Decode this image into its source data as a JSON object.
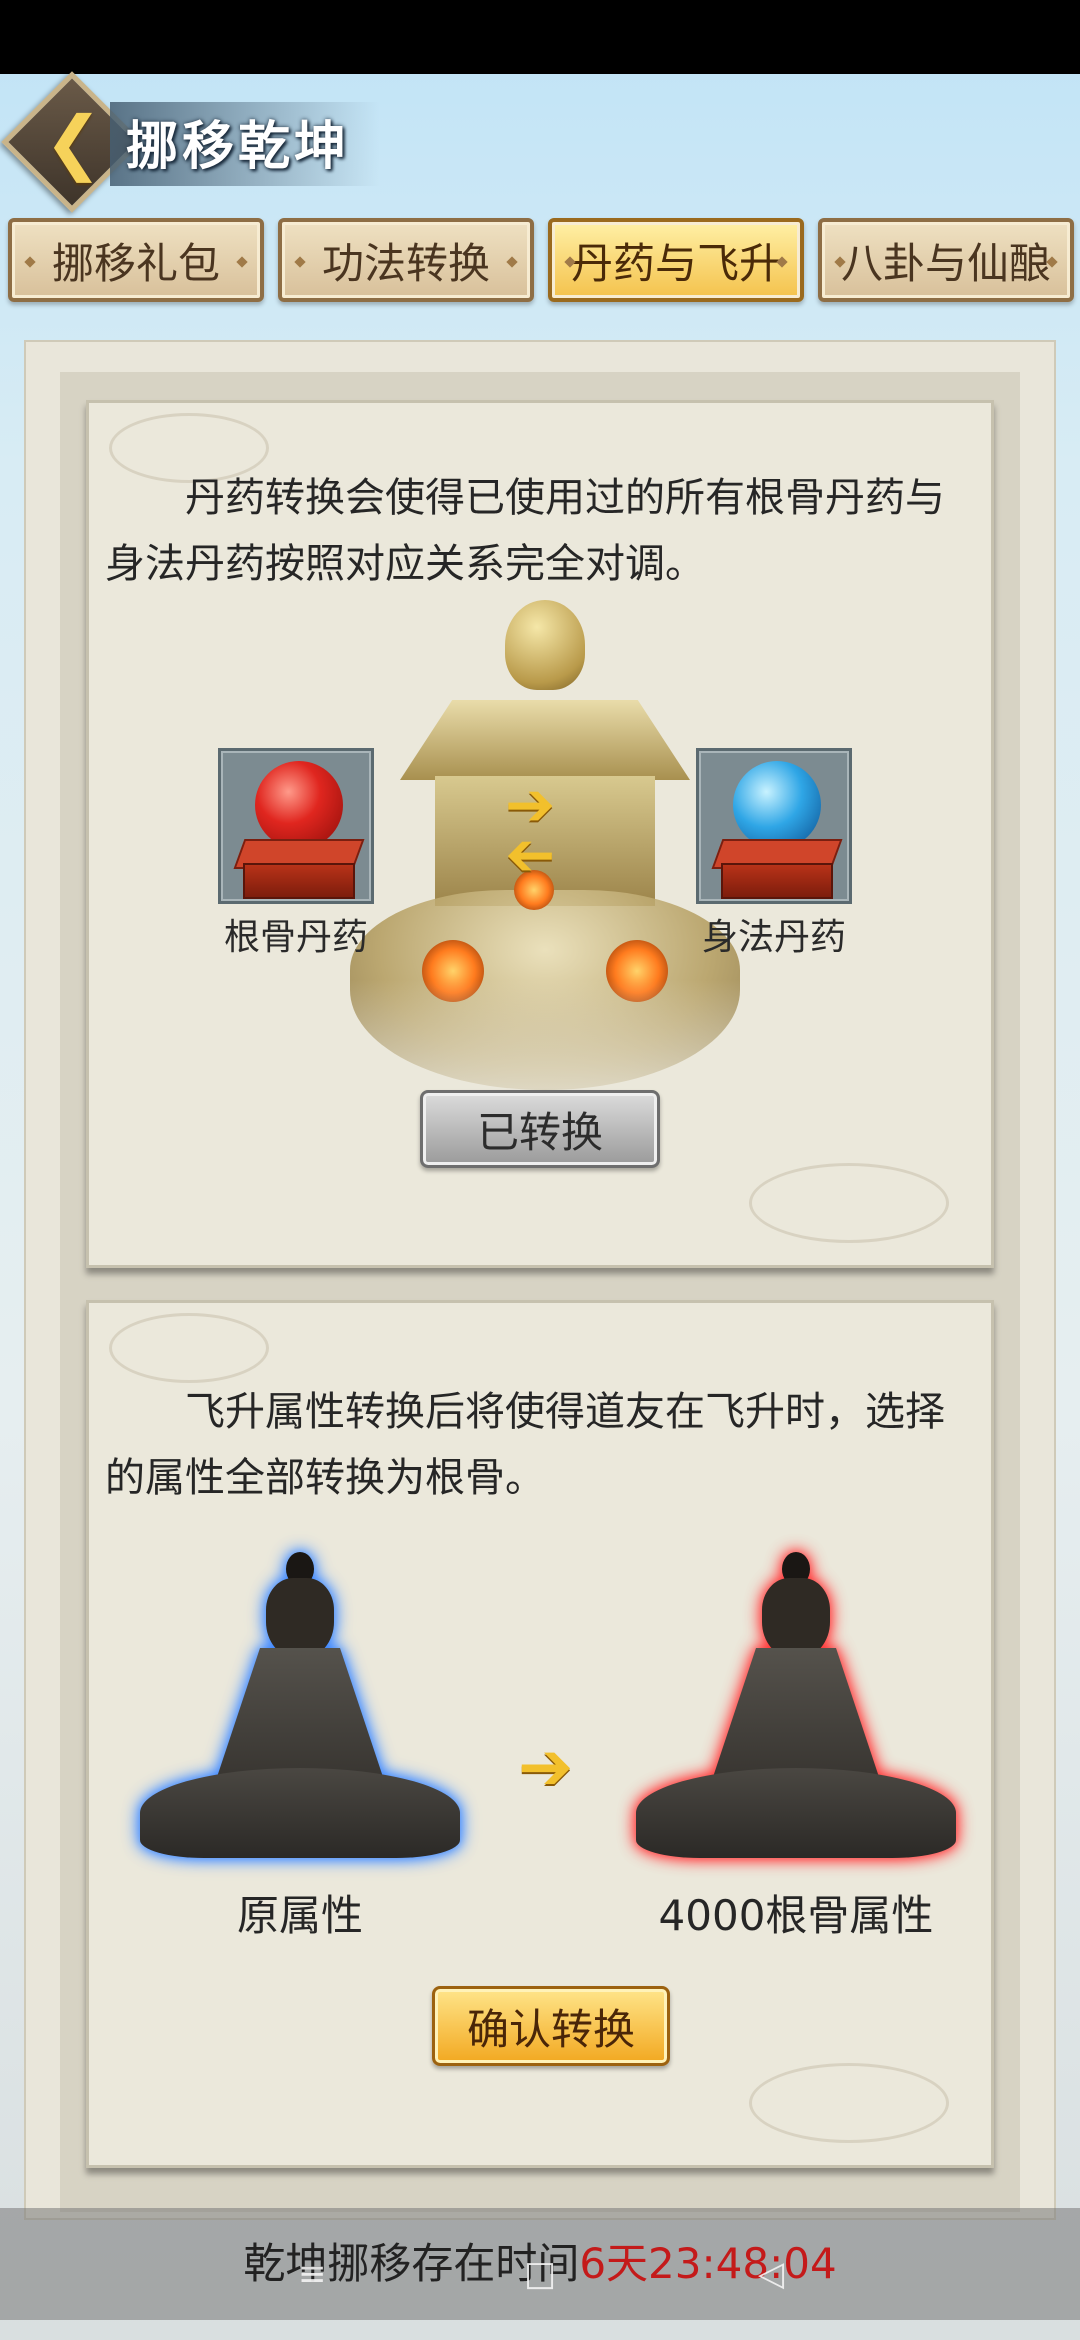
{
  "header": {
    "title": "挪移乾坤",
    "back_icon": "chevron-left-icon"
  },
  "tabs": [
    {
      "label": "挪移礼包",
      "active": false
    },
    {
      "label": "功法转换",
      "active": false
    },
    {
      "label": "丹药与飞升",
      "active": true
    },
    {
      "label": "八卦与仙酿",
      "active": false
    }
  ],
  "pill_card": {
    "description": "丹药转换会使得已使用过的所有根骨丹药与身法丹药按照对应关系完全对调。",
    "left_item_label": "根骨丹药",
    "right_item_label": "身法丹药",
    "swap_icon": "swap-arrows-icon",
    "button_label": "已转换"
  },
  "ascend_card": {
    "description": "飞升属性转换后将使得道友在飞升时，选择的属性全部转换为根骨。",
    "left_label": "原属性",
    "right_label": "4000根骨属性",
    "arrow_icon": "arrow-right-icon",
    "button_label": "确认转换"
  },
  "footer": {
    "prefix": "乾坤挪移存在时间",
    "timer": "6天23:48:04"
  },
  "colors": {
    "accent_gold": "#f2c02c",
    "timer_red": "#c41a1a"
  }
}
